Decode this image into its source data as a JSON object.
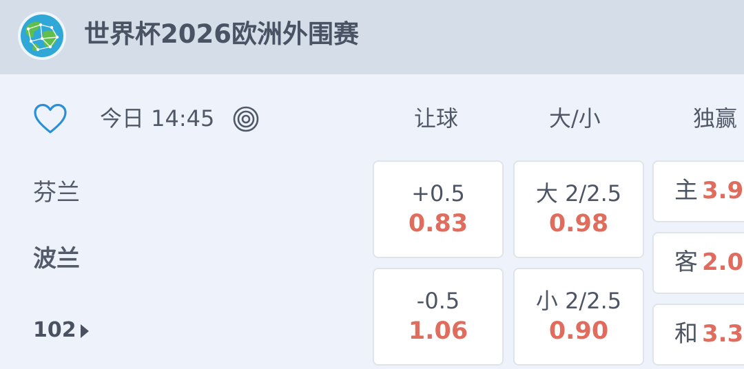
{
  "header": {
    "title": "世界杯2026欧洲外围赛"
  },
  "match": {
    "time": "今日 14:45",
    "home_team": "芬兰",
    "away_team": "波兰",
    "more_markets": "102"
  },
  "columns": {
    "handicap": "让球",
    "over_under": "大/小",
    "winner": "独赢"
  },
  "handicap": [
    {
      "line": "+0.5",
      "odds": "0.83"
    },
    {
      "line": "-0.5",
      "odds": "1.06"
    }
  ],
  "over_under": [
    {
      "line": "大 2/2.5",
      "odds": "0.98"
    },
    {
      "line": "小 2/2.5",
      "odds": "0.90"
    }
  ],
  "winner": [
    {
      "label": "主",
      "odds": "3.9"
    },
    {
      "label": "客",
      "odds": "2.0"
    },
    {
      "label": "和",
      "odds": "3.3"
    }
  ],
  "colors": {
    "header_bg": "#d5dde9",
    "page_bg": "#eef3fb",
    "odds_accent": "#e06c5e",
    "favorite_icon": "#2a8fd6"
  },
  "icons": {
    "logo": "globe-logo-icon",
    "favorite": "heart-outline-icon",
    "live": "target-icon",
    "more": "caret-right-icon"
  }
}
